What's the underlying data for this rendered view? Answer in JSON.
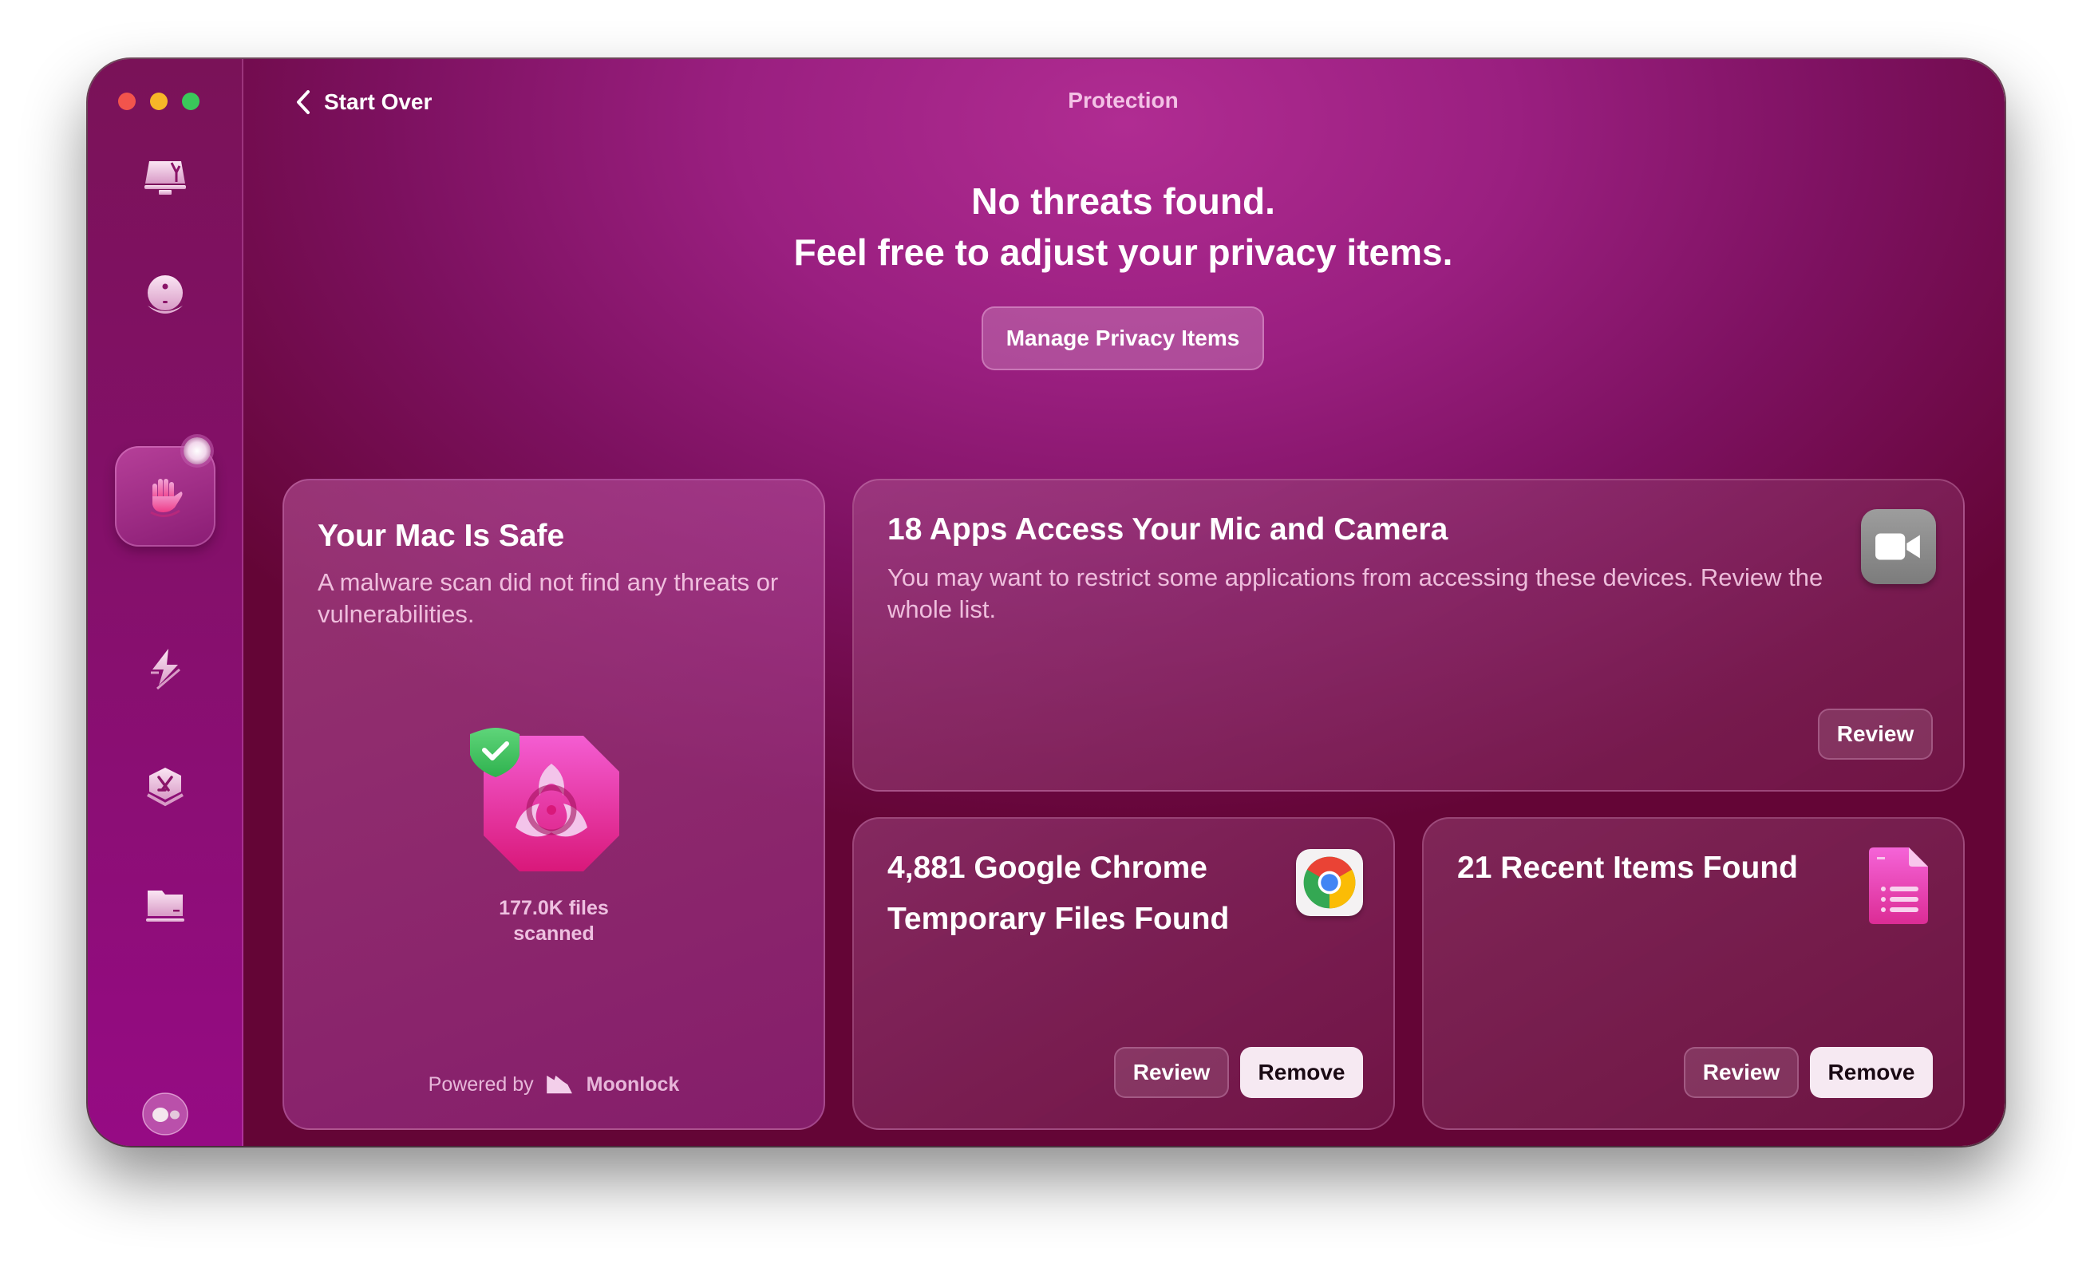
{
  "window": {
    "title": "Protection",
    "traffic_lights": [
      "close",
      "minimize",
      "zoom"
    ]
  },
  "toolbar": {
    "back_label": "Start Over",
    "back_icon": "chevron-left-icon"
  },
  "sidebar": {
    "items": [
      {
        "name": "smart-care",
        "icon": "monitor-broom-icon",
        "active": false
      },
      {
        "name": "cleanup",
        "icon": "disk-sphere-icon",
        "active": false
      },
      {
        "name": "protection",
        "icon": "hand-stop-icon",
        "active": true
      },
      {
        "name": "performance",
        "icon": "lightning-icon",
        "active": false
      },
      {
        "name": "applications",
        "icon": "app-hexagon-icon",
        "active": false
      },
      {
        "name": "my-clutter",
        "icon": "folder-icon",
        "active": false
      }
    ],
    "footer_icon": "assistant-icon"
  },
  "hero": {
    "line1": "No threats found.",
    "line2": "Feel free to adjust your privacy items.",
    "button_label": "Manage Privacy Items"
  },
  "cards": {
    "safe": {
      "title": "Your Mac Is Safe",
      "description": "A malware scan did not find any threats or vulnerabilities.",
      "files_count": "177.0K files",
      "files_label": "scanned",
      "powered_by": "Powered by",
      "brand": "Moonlock"
    },
    "mic": {
      "title": "18 Apps Access Your Mic and Camera",
      "description": "You may want to restrict some applications from accessing these devices. Review the whole list.",
      "review_label": "Review"
    },
    "chrome": {
      "title_line1": "4,881 Google Chrome",
      "title_line2": "Temporary Files Found",
      "review_label": "Review",
      "remove_label": "Remove"
    },
    "recent": {
      "title": "21 Recent Items Found",
      "review_label": "Review",
      "remove_label": "Remove"
    }
  },
  "colors": {
    "accent": "#b02c92",
    "dark": "#640536",
    "shield_green": "#3ac85a",
    "biohazard_pink": "#e9389f"
  }
}
